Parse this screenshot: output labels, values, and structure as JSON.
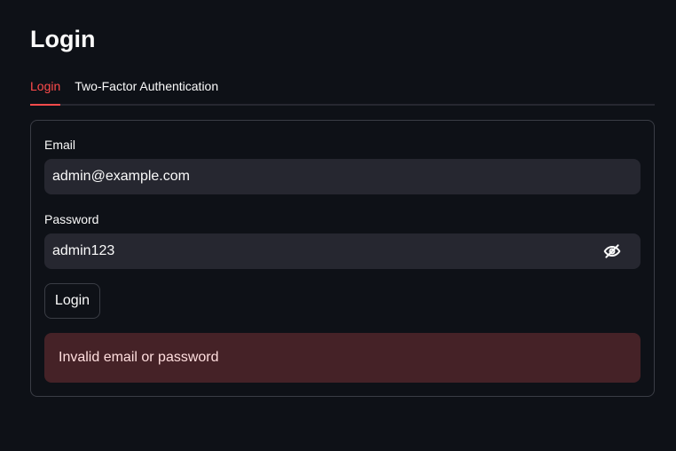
{
  "page": {
    "title": "Login"
  },
  "tabs": [
    {
      "label": "Login",
      "active": true
    },
    {
      "label": "Two-Factor Authentication",
      "active": false
    }
  ],
  "form": {
    "email": {
      "label": "Email",
      "value": "admin@example.com"
    },
    "password": {
      "label": "Password",
      "value": "admin123",
      "toggle_icon": "eye-slash-icon"
    },
    "submit_label": "Login",
    "error_message": "Invalid email or password"
  },
  "colors": {
    "background": "#0e1117",
    "accent": "#ff4b4b",
    "input_bg": "#262730",
    "error_bg": "#452227",
    "error_text": "#ffdede"
  }
}
